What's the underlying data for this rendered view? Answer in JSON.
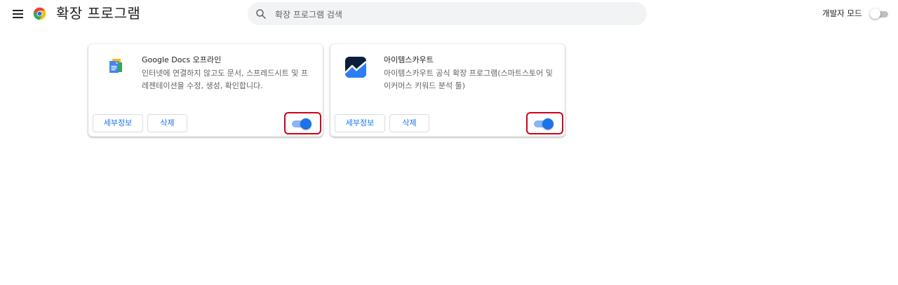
{
  "header": {
    "title": "확장 프로그램",
    "search_placeholder": "확장 프로그램 검색",
    "dev_mode_label": "개발자 모드",
    "dev_mode_enabled": false
  },
  "extensions": [
    {
      "name": "Google Docs 오프라인",
      "description": "인터넷에 연결하지 않고도 문서, 스프레드시트 및 프레젠테이션을 수정, 생성, 확인합니다.",
      "details_label": "세부정보",
      "remove_label": "삭제",
      "enabled": true,
      "icon": "google-docs-icon"
    },
    {
      "name": "아이템스카우트",
      "description": "아이템스카우트 공식 확장 프로그램(스마트스토어 및 이커머스 키워드 분석 툴)",
      "details_label": "세부정보",
      "remove_label": "삭제",
      "enabled": true,
      "icon": "itemscout-icon"
    }
  ],
  "colors": {
    "accent": "#1a73e8",
    "toggle_track_on": "#8ab4f8",
    "highlight_box": "#d0021b",
    "search_bg": "#f1f3f4"
  }
}
